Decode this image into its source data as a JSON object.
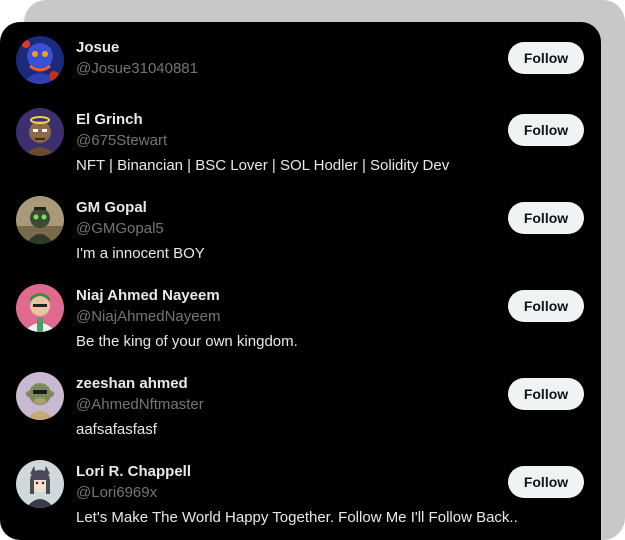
{
  "users": [
    {
      "name": "Josue",
      "handle": "@Josue31040881",
      "bio": "",
      "follow_label": "Follow"
    },
    {
      "name": "El Grinch",
      "handle": "@675Stewart",
      "bio": "NFT | Binancian | BSC Lover | SOL Hodler | Solidity Dev",
      "follow_label": "Follow"
    },
    {
      "name": "GM Gopal",
      "handle": "@GMGopal5",
      "bio": "I'm a innocent BOY",
      "follow_label": "Follow"
    },
    {
      "name": "Niaj Ahmed Nayeem",
      "handle": "@NiajAhmedNayeem",
      "bio": "Be the king of your own kingdom.",
      "follow_label": "Follow"
    },
    {
      "name": "zeeshan ahmed",
      "handle": "@AhmedNftmaster",
      "bio": "aafsafasfasf",
      "follow_label": "Follow"
    },
    {
      "name": "Lori R. Chappell",
      "handle": "@Lori6969x",
      "bio": "Let's Make The World Happy Together. Follow Me I'll Follow Back..",
      "follow_label": "Follow"
    }
  ],
  "colors": {
    "panel_bg": "#000000",
    "name_text": "#e7e9ea",
    "handle_text": "#71767b",
    "follow_button_bg": "#eff3f4",
    "follow_button_text": "#0f1419"
  }
}
